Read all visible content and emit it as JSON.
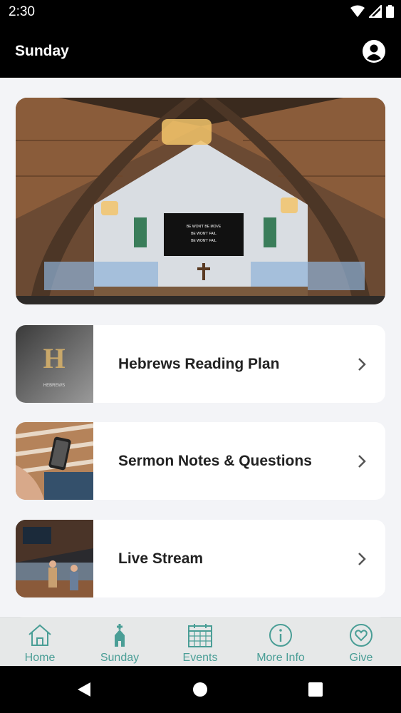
{
  "status": {
    "time": "2:30"
  },
  "header": {
    "title": "Sunday"
  },
  "cards": [
    {
      "label": "Hebrews Reading Plan",
      "thumb_text": "HEBREWS"
    },
    {
      "label": "Sermon Notes & Questions"
    },
    {
      "label": "Live Stream"
    }
  ],
  "hero_screen_text": [
    "BE WON'T BE MOVE",
    "BE WON'T FAIL",
    "BE WON'T FAIL"
  ],
  "tabs": [
    {
      "label": "Home",
      "icon": "home-icon"
    },
    {
      "label": "Sunday",
      "icon": "church-icon"
    },
    {
      "label": "Events",
      "icon": "calendar-icon"
    },
    {
      "label": "More Info",
      "icon": "info-icon"
    },
    {
      "label": "Give",
      "icon": "heart-icon"
    }
  ],
  "colors": {
    "accent": "#4a9e96",
    "header_bg": "#000000",
    "page_bg": "#f3f4f7"
  }
}
